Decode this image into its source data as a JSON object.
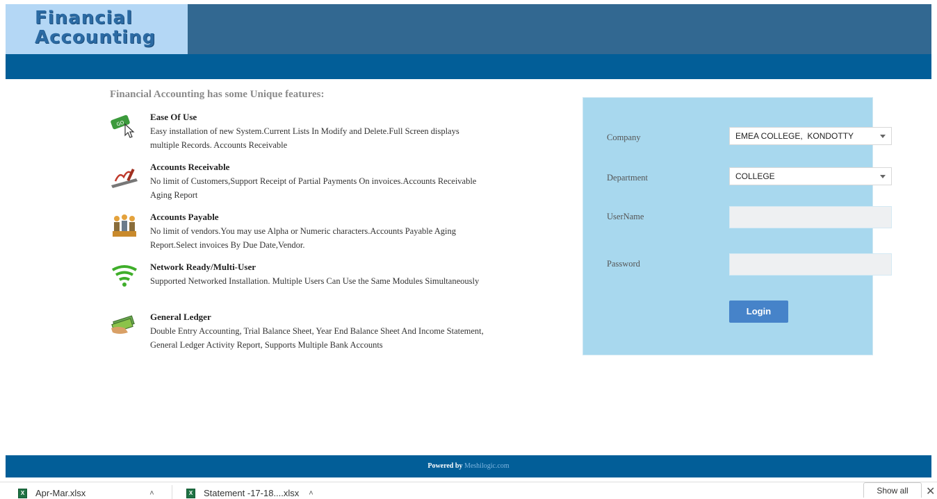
{
  "header": {
    "logo_line1": "Financial",
    "logo_line2": "Accounting"
  },
  "features": {
    "title": "Financial Accounting has some Unique features:",
    "items": [
      {
        "icon": "cursor-click-icon",
        "title": "Ease Of Use",
        "desc": "Easy installation of new System.Current Lists In Modify and Delete.Full Screen displays multiple Records. Accounts Receivable"
      },
      {
        "icon": "hand-writing-icon",
        "title": "Accounts Receivable",
        "desc": "No limit of Customers,Support Receipt of Partial Payments On invoices.Accounts Receivable Aging Report"
      },
      {
        "icon": "users-group-icon",
        "title": "Accounts Payable",
        "desc": "No limit of vendors.You may use Alpha or Numeric characters.Accounts Payable Aging Report.Select invoices By Due Date,Vendor."
      },
      {
        "icon": "wifi-icon",
        "title": "Network Ready/Multi-User",
        "desc": "Supported Networked Installation. Multiple Users Can Use the Same Modules Simultaneously"
      },
      {
        "icon": "money-icon",
        "title": "General Ledger",
        "desc": "Double Entry Accounting, Trial Balance Sheet, Year End Balance Sheet And Income Statement, General Ledger Activity Report, Supports Multiple Bank Accounts"
      }
    ]
  },
  "login": {
    "company_label": "Company",
    "company_value": "EMEA COLLEGE,  KONDOTTY",
    "department_label": "Department",
    "department_value": "COLLEGE",
    "username_label": "UserName",
    "username_value": "",
    "password_label": "Password",
    "password_value": "",
    "login_button": "Login"
  },
  "footer": {
    "powered_by": "Powered by",
    "link": "Meshilogic.com"
  },
  "downloads": {
    "items": [
      "Apr-Mar.xlsx",
      "Statement -17-18....xlsx"
    ],
    "show_all": "Show all"
  },
  "colors": {
    "header": "#326891",
    "bar": "#025e98",
    "logo_bg": "#b4d7f5",
    "login_bg": "#a8d8ee",
    "button": "#4683c9"
  }
}
